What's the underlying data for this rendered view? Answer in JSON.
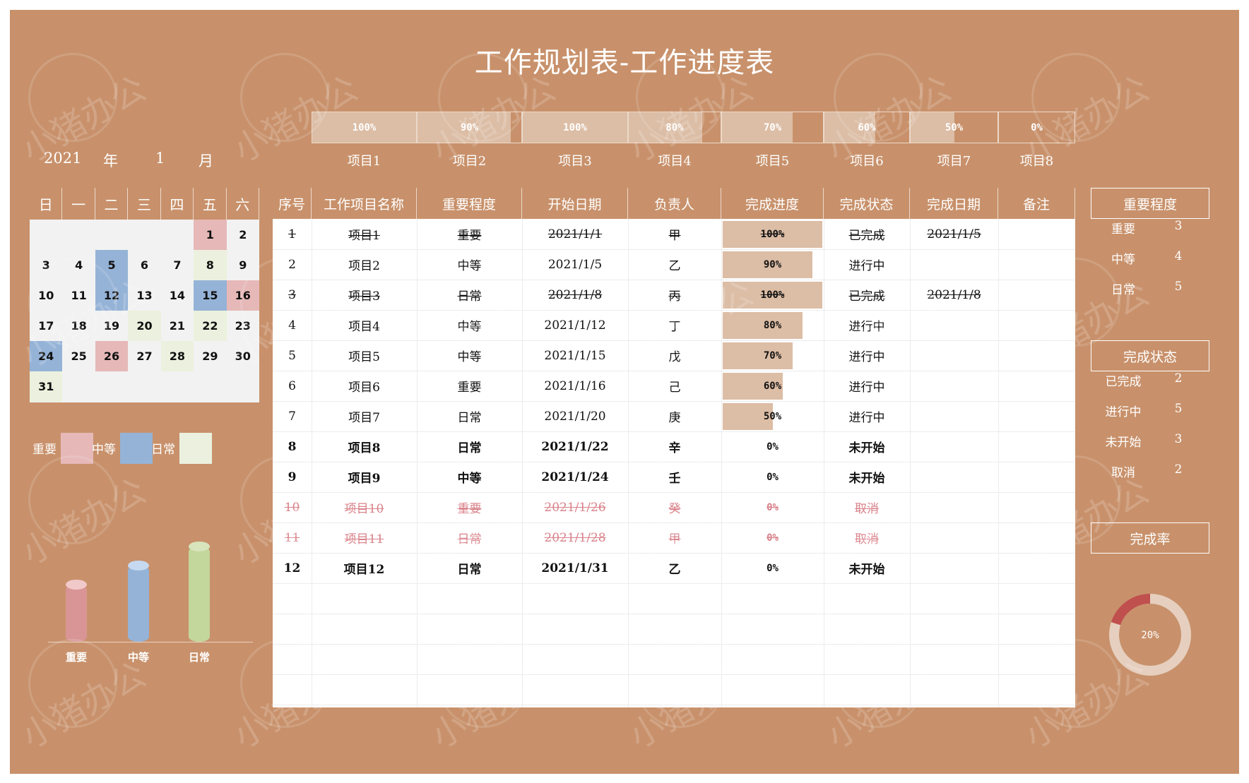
{
  "title": "工作规划表-工作进度表",
  "year": "2021",
  "year_unit": "年",
  "month": "1",
  "month_unit": "月",
  "colors": {
    "background": "#c8916b",
    "progress_fill": "#dcbda5",
    "important": "#e6b8b8",
    "medium": "#95b3d7",
    "daily": "#ebf1de",
    "cancel_text": "#d9828a",
    "donut_done": "#c0504d",
    "donut_rest": "#e6cfbf"
  },
  "top_progress": [
    {
      "label": "项目1",
      "value": "100%",
      "fraction": 1.0
    },
    {
      "label": "项目2",
      "value": "90%",
      "fraction": 0.9
    },
    {
      "label": "项目3",
      "value": "100%",
      "fraction": 1.0
    },
    {
      "label": "项目4",
      "value": "80%",
      "fraction": 0.8
    },
    {
      "label": "项目5",
      "value": "70%",
      "fraction": 0.7
    },
    {
      "label": "项目6",
      "value": "60%",
      "fraction": 0.6
    },
    {
      "label": "项目7",
      "value": "50%",
      "fraction": 0.5
    },
    {
      "label": "项目8",
      "value": "0%",
      "fraction": 0.0
    }
  ],
  "calendar": {
    "weekdays": [
      "日",
      "一",
      "二",
      "三",
      "四",
      "五",
      "六"
    ],
    "days": [
      {
        "d": "1",
        "t": "important"
      },
      {
        "d": "2",
        "t": ""
      },
      {
        "d": "3",
        "t": ""
      },
      {
        "d": "4",
        "t": ""
      },
      {
        "d": "5",
        "t": "medium"
      },
      {
        "d": "6",
        "t": ""
      },
      {
        "d": "7",
        "t": ""
      },
      {
        "d": "8",
        "t": "daily"
      },
      {
        "d": "9",
        "t": ""
      },
      {
        "d": "10",
        "t": ""
      },
      {
        "d": "11",
        "t": ""
      },
      {
        "d": "12",
        "t": "medium"
      },
      {
        "d": "13",
        "t": ""
      },
      {
        "d": "14",
        "t": ""
      },
      {
        "d": "15",
        "t": "medium"
      },
      {
        "d": "16",
        "t": "important"
      },
      {
        "d": "17",
        "t": ""
      },
      {
        "d": "18",
        "t": ""
      },
      {
        "d": "19",
        "t": ""
      },
      {
        "d": "20",
        "t": "daily"
      },
      {
        "d": "21",
        "t": ""
      },
      {
        "d": "22",
        "t": "daily"
      },
      {
        "d": "23",
        "t": ""
      },
      {
        "d": "24",
        "t": "medium"
      },
      {
        "d": "25",
        "t": ""
      },
      {
        "d": "26",
        "t": "important"
      },
      {
        "d": "27",
        "t": ""
      },
      {
        "d": "28",
        "t": "daily"
      },
      {
        "d": "29",
        "t": ""
      },
      {
        "d": "30",
        "t": ""
      },
      {
        "d": "31",
        "t": "daily"
      }
    ],
    "first_weekday": 5
  },
  "legend": [
    {
      "label": "重要",
      "type": "important"
    },
    {
      "label": "中等",
      "type": "medium"
    },
    {
      "label": "日常",
      "type": "daily"
    }
  ],
  "chart_data": {
    "type": "bar",
    "categories": [
      "重要",
      "中等",
      "日常"
    ],
    "values": [
      3,
      4,
      5
    ],
    "ylim": [
      0,
      5
    ]
  },
  "table": {
    "headers": [
      "序号",
      "工作项目名称",
      "重要程度",
      "开始日期",
      "负责人",
      "完成进度",
      "完成状态",
      "完成日期",
      "备注"
    ],
    "rows": [
      {
        "no": "1",
        "name": "项目1",
        "level": "重要",
        "start": "2021/1/1",
        "owner": "甲",
        "progress": "100%",
        "fraction": 1.0,
        "status": "已完成",
        "done": "2021/1/5",
        "note": "",
        "state": "done"
      },
      {
        "no": "2",
        "name": "项目2",
        "level": "中等",
        "start": "2021/1/5",
        "owner": "乙",
        "progress": "90%",
        "fraction": 0.9,
        "status": "进行中",
        "done": "",
        "note": "",
        "state": "active"
      },
      {
        "no": "3",
        "name": "项目3",
        "level": "日常",
        "start": "2021/1/8",
        "owner": "丙",
        "progress": "100%",
        "fraction": 1.0,
        "status": "已完成",
        "done": "2021/1/8",
        "note": "",
        "state": "done"
      },
      {
        "no": "4",
        "name": "项目4",
        "level": "中等",
        "start": "2021/1/12",
        "owner": "丁",
        "progress": "80%",
        "fraction": 0.8,
        "status": "进行中",
        "done": "",
        "note": "",
        "state": "active"
      },
      {
        "no": "5",
        "name": "项目5",
        "level": "中等",
        "start": "2021/1/15",
        "owner": "戊",
        "progress": "70%",
        "fraction": 0.7,
        "status": "进行中",
        "done": "",
        "note": "",
        "state": "active"
      },
      {
        "no": "6",
        "name": "项目6",
        "level": "重要",
        "start": "2021/1/16",
        "owner": "己",
        "progress": "60%",
        "fraction": 0.6,
        "status": "进行中",
        "done": "",
        "note": "",
        "state": "active"
      },
      {
        "no": "7",
        "name": "项目7",
        "level": "日常",
        "start": "2021/1/20",
        "owner": "庚",
        "progress": "50%",
        "fraction": 0.5,
        "status": "进行中",
        "done": "",
        "note": "",
        "state": "active"
      },
      {
        "no": "8",
        "name": "项目8",
        "level": "日常",
        "start": "2021/1/22",
        "owner": "辛",
        "progress": "0%",
        "fraction": 0.0,
        "status": "未开始",
        "done": "",
        "note": "",
        "state": "notstart"
      },
      {
        "no": "9",
        "name": "项目9",
        "level": "中等",
        "start": "2021/1/24",
        "owner": "壬",
        "progress": "0%",
        "fraction": 0.0,
        "status": "未开始",
        "done": "",
        "note": "",
        "state": "notstart"
      },
      {
        "no": "10",
        "name": "项目10",
        "level": "重要",
        "start": "2021/1/26",
        "owner": "癸",
        "progress": "0%",
        "fraction": 0.0,
        "status": "取消",
        "done": "",
        "note": "",
        "state": "cancel"
      },
      {
        "no": "11",
        "name": "项目11",
        "level": "日常",
        "start": "2021/1/28",
        "owner": "甲",
        "progress": "0%",
        "fraction": 0.0,
        "status": "取消",
        "done": "",
        "note": "",
        "state": "cancel"
      },
      {
        "no": "12",
        "name": "项目12",
        "level": "日常",
        "start": "2021/1/31",
        "owner": "乙",
        "progress": "0%",
        "fraction": 0.0,
        "status": "未开始",
        "done": "",
        "note": "",
        "state": "notstart"
      }
    ]
  },
  "importance_summary": {
    "title": "重要程度",
    "items": [
      {
        "label": "重要",
        "value": "3"
      },
      {
        "label": "中等",
        "value": "4"
      },
      {
        "label": "日常",
        "value": "5"
      }
    ]
  },
  "status_summary": {
    "title": "完成状态",
    "items": [
      {
        "label": "已完成",
        "value": "2"
      },
      {
        "label": "进行中",
        "value": "5"
      },
      {
        "label": "未开始",
        "value": "3"
      },
      {
        "label": "取消",
        "value": "2"
      }
    ]
  },
  "completion": {
    "title": "完成率",
    "value": "20%",
    "fraction": 0.2
  },
  "watermark": "小猪办公"
}
